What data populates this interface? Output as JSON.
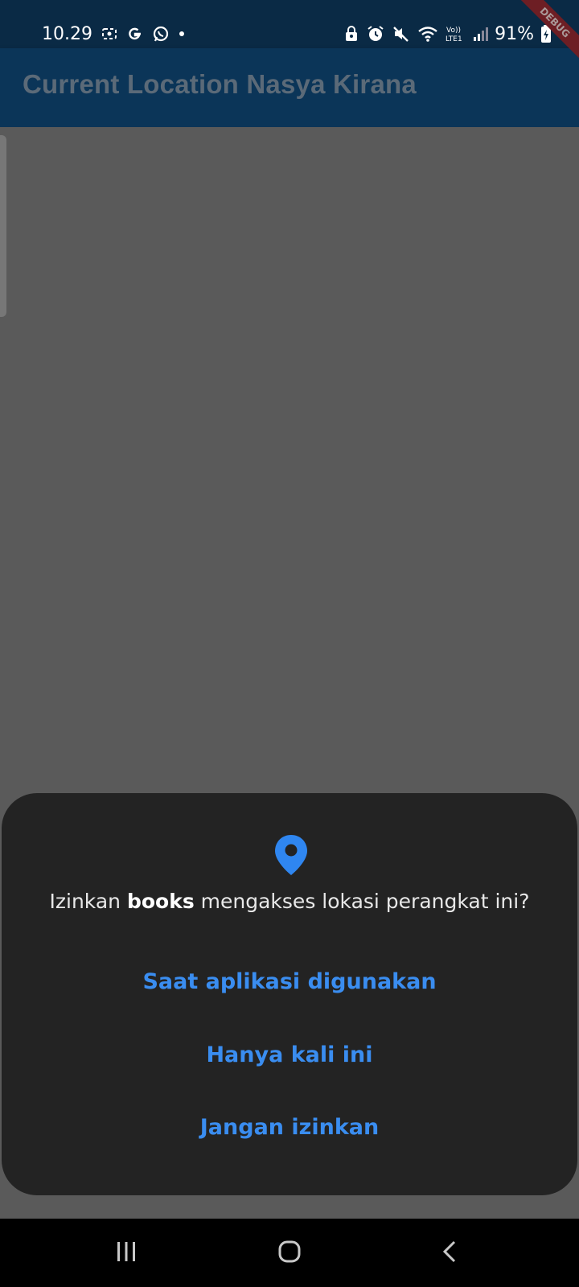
{
  "status_bar": {
    "time": "10.29",
    "battery": "91%",
    "left_icons": [
      "screen-record-icon",
      "google-icon",
      "whatsapp-icon",
      "dot-icon"
    ],
    "right_icons": [
      "lock-icon",
      "alarm-icon",
      "mute-icon",
      "wifi-icon",
      "volte-icon",
      "signal-icon",
      "battery-icon"
    ],
    "volte_label": "Vo))\nLTE1"
  },
  "app_bar": {
    "title": "Current Location Nasya Kirana",
    "debug_banner": "DEBUG"
  },
  "permission_dialog": {
    "icon": "location-pin-icon",
    "prompt_prefix": "Izinkan ",
    "app_name": "books",
    "prompt_suffix": " mengakses lokasi perangkat ini?",
    "options": [
      "Saat aplikasi digunakan",
      "Hanya kali ini",
      "Jangan izinkan"
    ]
  },
  "nav_bar": {
    "buttons": [
      "recent-apps-icon",
      "home-icon",
      "back-icon"
    ]
  },
  "colors": {
    "status_bar": "#0a2a45",
    "app_bar": "#0b3558",
    "overlay": "#5a5a5a",
    "sheet": "#232323",
    "accent": "#3a8df0"
  }
}
